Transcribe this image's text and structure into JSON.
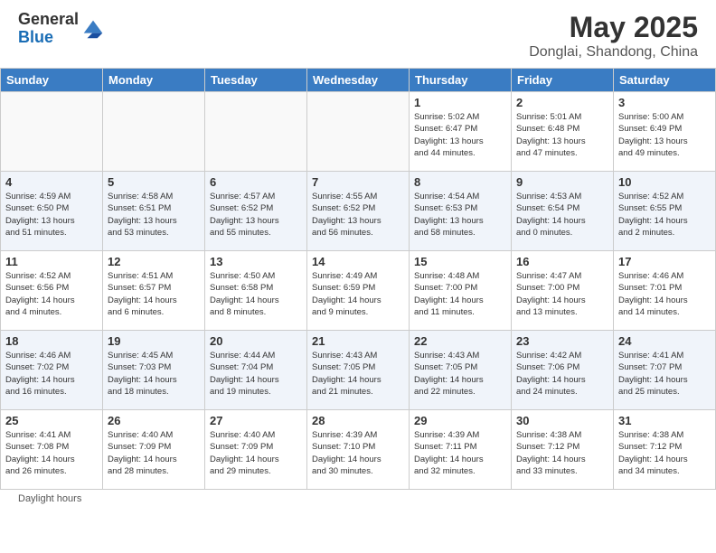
{
  "header": {
    "logo_general": "General",
    "logo_blue": "Blue",
    "month_year": "May 2025",
    "location": "Donglai, Shandong, China"
  },
  "days_of_week": [
    "Sunday",
    "Monday",
    "Tuesday",
    "Wednesday",
    "Thursday",
    "Friday",
    "Saturday"
  ],
  "weeks": [
    [
      {
        "num": "",
        "info": ""
      },
      {
        "num": "",
        "info": ""
      },
      {
        "num": "",
        "info": ""
      },
      {
        "num": "",
        "info": ""
      },
      {
        "num": "1",
        "info": "Sunrise: 5:02 AM\nSunset: 6:47 PM\nDaylight: 13 hours\nand 44 minutes."
      },
      {
        "num": "2",
        "info": "Sunrise: 5:01 AM\nSunset: 6:48 PM\nDaylight: 13 hours\nand 47 minutes."
      },
      {
        "num": "3",
        "info": "Sunrise: 5:00 AM\nSunset: 6:49 PM\nDaylight: 13 hours\nand 49 minutes."
      }
    ],
    [
      {
        "num": "4",
        "info": "Sunrise: 4:59 AM\nSunset: 6:50 PM\nDaylight: 13 hours\nand 51 minutes."
      },
      {
        "num": "5",
        "info": "Sunrise: 4:58 AM\nSunset: 6:51 PM\nDaylight: 13 hours\nand 53 minutes."
      },
      {
        "num": "6",
        "info": "Sunrise: 4:57 AM\nSunset: 6:52 PM\nDaylight: 13 hours\nand 55 minutes."
      },
      {
        "num": "7",
        "info": "Sunrise: 4:55 AM\nSunset: 6:52 PM\nDaylight: 13 hours\nand 56 minutes."
      },
      {
        "num": "8",
        "info": "Sunrise: 4:54 AM\nSunset: 6:53 PM\nDaylight: 13 hours\nand 58 minutes."
      },
      {
        "num": "9",
        "info": "Sunrise: 4:53 AM\nSunset: 6:54 PM\nDaylight: 14 hours\nand 0 minutes."
      },
      {
        "num": "10",
        "info": "Sunrise: 4:52 AM\nSunset: 6:55 PM\nDaylight: 14 hours\nand 2 minutes."
      }
    ],
    [
      {
        "num": "11",
        "info": "Sunrise: 4:52 AM\nSunset: 6:56 PM\nDaylight: 14 hours\nand 4 minutes."
      },
      {
        "num": "12",
        "info": "Sunrise: 4:51 AM\nSunset: 6:57 PM\nDaylight: 14 hours\nand 6 minutes."
      },
      {
        "num": "13",
        "info": "Sunrise: 4:50 AM\nSunset: 6:58 PM\nDaylight: 14 hours\nand 8 minutes."
      },
      {
        "num": "14",
        "info": "Sunrise: 4:49 AM\nSunset: 6:59 PM\nDaylight: 14 hours\nand 9 minutes."
      },
      {
        "num": "15",
        "info": "Sunrise: 4:48 AM\nSunset: 7:00 PM\nDaylight: 14 hours\nand 11 minutes."
      },
      {
        "num": "16",
        "info": "Sunrise: 4:47 AM\nSunset: 7:00 PM\nDaylight: 14 hours\nand 13 minutes."
      },
      {
        "num": "17",
        "info": "Sunrise: 4:46 AM\nSunset: 7:01 PM\nDaylight: 14 hours\nand 14 minutes."
      }
    ],
    [
      {
        "num": "18",
        "info": "Sunrise: 4:46 AM\nSunset: 7:02 PM\nDaylight: 14 hours\nand 16 minutes."
      },
      {
        "num": "19",
        "info": "Sunrise: 4:45 AM\nSunset: 7:03 PM\nDaylight: 14 hours\nand 18 minutes."
      },
      {
        "num": "20",
        "info": "Sunrise: 4:44 AM\nSunset: 7:04 PM\nDaylight: 14 hours\nand 19 minutes."
      },
      {
        "num": "21",
        "info": "Sunrise: 4:43 AM\nSunset: 7:05 PM\nDaylight: 14 hours\nand 21 minutes."
      },
      {
        "num": "22",
        "info": "Sunrise: 4:43 AM\nSunset: 7:05 PM\nDaylight: 14 hours\nand 22 minutes."
      },
      {
        "num": "23",
        "info": "Sunrise: 4:42 AM\nSunset: 7:06 PM\nDaylight: 14 hours\nand 24 minutes."
      },
      {
        "num": "24",
        "info": "Sunrise: 4:41 AM\nSunset: 7:07 PM\nDaylight: 14 hours\nand 25 minutes."
      }
    ],
    [
      {
        "num": "25",
        "info": "Sunrise: 4:41 AM\nSunset: 7:08 PM\nDaylight: 14 hours\nand 26 minutes."
      },
      {
        "num": "26",
        "info": "Sunrise: 4:40 AM\nSunset: 7:09 PM\nDaylight: 14 hours\nand 28 minutes."
      },
      {
        "num": "27",
        "info": "Sunrise: 4:40 AM\nSunset: 7:09 PM\nDaylight: 14 hours\nand 29 minutes."
      },
      {
        "num": "28",
        "info": "Sunrise: 4:39 AM\nSunset: 7:10 PM\nDaylight: 14 hours\nand 30 minutes."
      },
      {
        "num": "29",
        "info": "Sunrise: 4:39 AM\nSunset: 7:11 PM\nDaylight: 14 hours\nand 32 minutes."
      },
      {
        "num": "30",
        "info": "Sunrise: 4:38 AM\nSunset: 7:12 PM\nDaylight: 14 hours\nand 33 minutes."
      },
      {
        "num": "31",
        "info": "Sunrise: 4:38 AM\nSunset: 7:12 PM\nDaylight: 14 hours\nand 34 minutes."
      }
    ]
  ],
  "footer": {
    "daylight_hours": "Daylight hours"
  }
}
